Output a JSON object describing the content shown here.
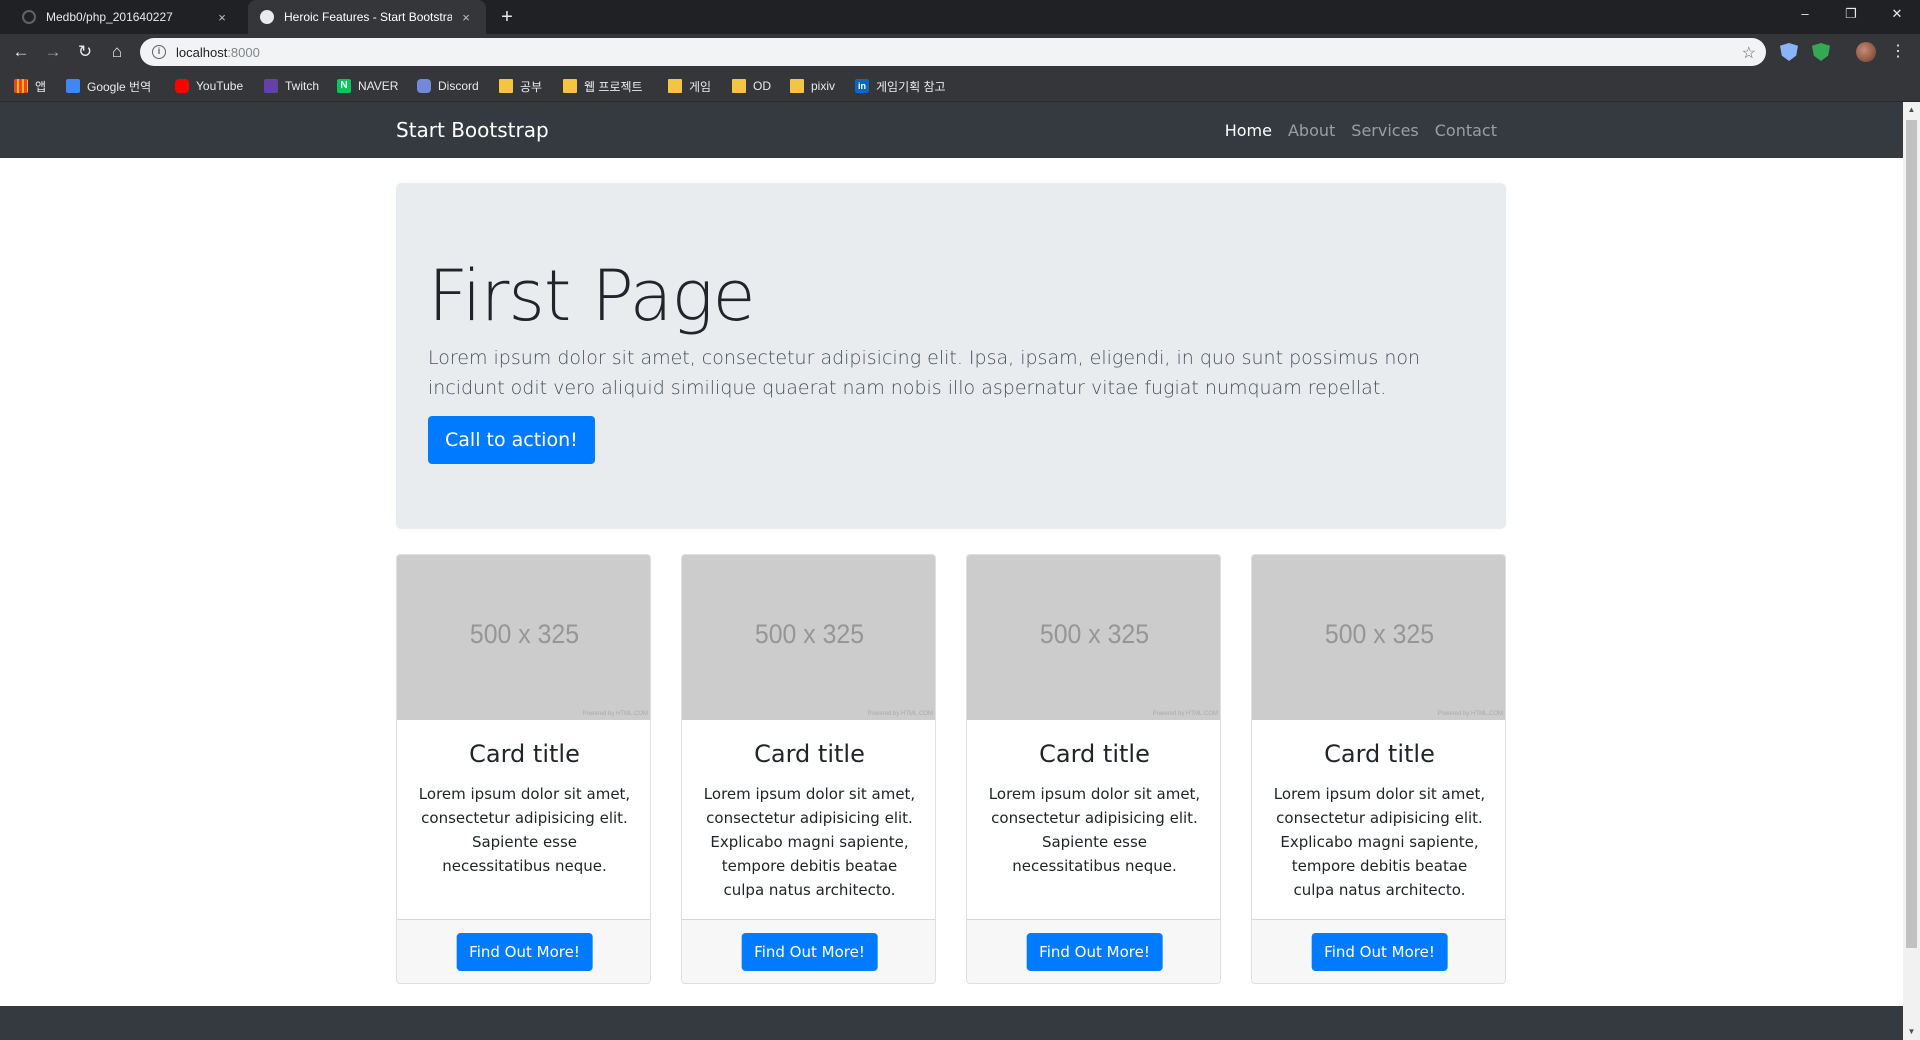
{
  "browser": {
    "tabs": [
      {
        "title": "Medb0/php_201640227",
        "close": "×"
      },
      {
        "title": "Heroic Features - Start Bootstrap",
        "close": "×"
      }
    ],
    "new_tab": "+",
    "window_controls": {
      "minimize": "–",
      "restore": "❐",
      "close": "✕"
    },
    "nav": {
      "back": "←",
      "forward": "→",
      "reload": "↻",
      "home": "⌂"
    },
    "url_host": "localhost",
    "url_port": ":8000",
    "star": "☆",
    "menu": "⋮",
    "bookmarks": [
      {
        "label": "앱",
        "icon": "apps-icon"
      },
      {
        "label": "Google 번역",
        "icon": "google-translate-icon"
      },
      {
        "label": "YouTube",
        "icon": "youtube-icon"
      },
      {
        "label": "Twitch",
        "icon": "twitch-icon"
      },
      {
        "label": "NAVER",
        "icon": "naver-icon"
      },
      {
        "label": "Discord",
        "icon": "discord-icon"
      },
      {
        "label": "공부",
        "icon": "folder-icon"
      },
      {
        "label": "웹 프로젝트",
        "icon": "folder-icon"
      },
      {
        "label": "게임",
        "icon": "folder-icon"
      },
      {
        "label": "OD",
        "icon": "folder-icon"
      },
      {
        "label": "pixiv",
        "icon": "folder-icon"
      },
      {
        "label": "게임기획 참고",
        "icon": "linkedin-icon"
      }
    ]
  },
  "site": {
    "brand": "Start Bootstrap",
    "nav": [
      "Home",
      "About",
      "Services",
      "Contact"
    ],
    "active_nav": "Home",
    "jumbotron": {
      "title": "First Page",
      "lead": "Lorem ipsum dolor sit amet, consectetur adipisicing elit. Ipsa, ipsam, eligendi, in quo sunt possimus non incidunt odit vero aliquid similique quaerat nam nobis illo aspernatur vitae fugiat numquam repellat.",
      "cta": "Call to action!"
    },
    "cards": [
      {
        "image": "500 x 325",
        "powered": "Powered by HTML.COM",
        "title": "Card title",
        "text": "Lorem ipsum dolor sit amet, consectetur adipisicing elit. Sapiente esse necessitatibus neque.",
        "button": "Find Out More!"
      },
      {
        "image": "500 x 325",
        "powered": "Powered by HTML.COM",
        "title": "Card title",
        "text": "Lorem ipsum dolor sit amet, consectetur adipisicing elit. Explicabo magni sapiente, tempore debitis beatae culpa natus architecto.",
        "button": "Find Out More!"
      },
      {
        "image": "500 x 325",
        "powered": "Powered by HTML.COM",
        "title": "Card title",
        "text": "Lorem ipsum dolor sit amet, consectetur adipisicing elit. Sapiente esse necessitatibus neque.",
        "button": "Find Out More!"
      },
      {
        "image": "500 x 325",
        "powered": "Powered by HTML.COM",
        "title": "Card title",
        "text": "Lorem ipsum dolor sit amet, consectetur adipisicing elit. Explicabo magni sapiente, tempore debitis beatae culpa natus architecto.",
        "button": "Find Out More!"
      }
    ]
  },
  "colors": {
    "primary": "#007bff",
    "navbar": "#343a40",
    "jumbotron_bg": "#e9ecef",
    "placeholder_bg": "#cccccc"
  }
}
